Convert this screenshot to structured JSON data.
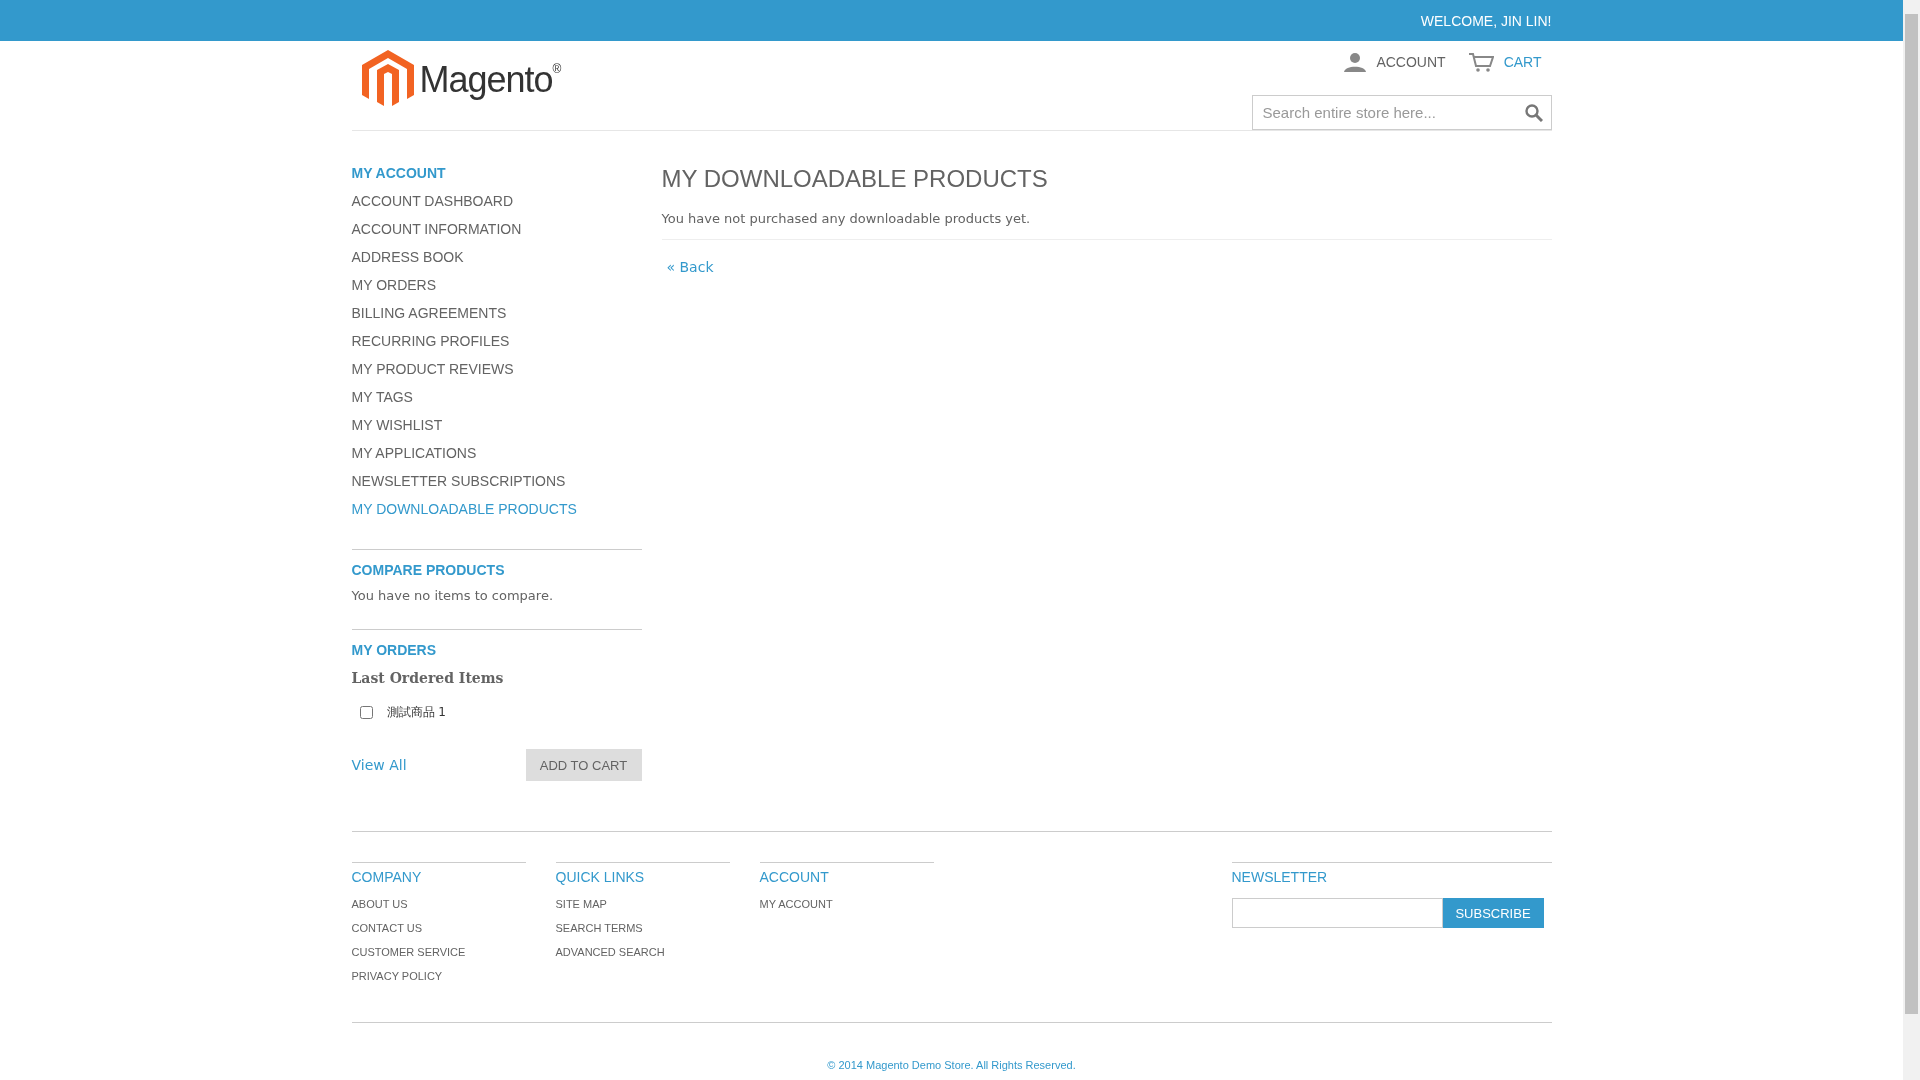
{
  "top_bar": {
    "welcome": "WELCOME, JIN LIN!"
  },
  "header": {
    "logo_text": "Magento",
    "logo_mark": "®",
    "links": [
      {
        "kind": "account",
        "label": "ACCOUNT"
      },
      {
        "kind": "cart",
        "label": "CART"
      }
    ],
    "search": {
      "placeholder": "Search entire store here..."
    }
  },
  "sidebar": {
    "title": "MY ACCOUNT",
    "items": [
      {
        "label": "ACCOUNT DASHBOARD",
        "selected": false
      },
      {
        "label": "ACCOUNT INFORMATION",
        "selected": false
      },
      {
        "label": "ADDRESS BOOK",
        "selected": false
      },
      {
        "label": "MY ORDERS",
        "selected": false
      },
      {
        "label": "BILLING AGREEMENTS",
        "selected": false
      },
      {
        "label": "RECURRING PROFILES",
        "selected": false
      },
      {
        "label": "MY PRODUCT REVIEWS",
        "selected": false
      },
      {
        "label": "MY TAGS",
        "selected": false
      },
      {
        "label": "MY WISHLIST",
        "selected": false
      },
      {
        "label": "MY APPLICATIONS",
        "selected": false
      },
      {
        "label": "NEWSLETTER SUBSCRIPTIONS",
        "selected": false
      },
      {
        "label": "MY DOWNLOADABLE PRODUCTS",
        "selected": true
      }
    ],
    "compare": {
      "title": "COMPARE PRODUCTS",
      "text": "You have no items to compare."
    },
    "orders": {
      "title": "MY ORDERS",
      "subtitle": "Last Ordered Items",
      "items": [
        {
          "name": "測試商品",
          "qty": "1",
          "checked": false
        }
      ],
      "view_all": "View All",
      "add_to_cart": "ADD TO CART"
    }
  },
  "main": {
    "title": "MY DOWNLOADABLE PRODUCTS",
    "message": "You have not purchased any downloadable products yet.",
    "back": "« Back"
  },
  "footer": {
    "columns": [
      {
        "title": "COMPANY",
        "links": [
          "ABOUT US",
          "CONTACT US",
          "CUSTOMER SERVICE",
          "PRIVACY POLICY"
        ]
      },
      {
        "title": "QUICK LINKS",
        "links": [
          "SITE MAP",
          "SEARCH TERMS",
          "ADVANCED SEARCH"
        ]
      },
      {
        "title": "ACCOUNT",
        "links": [
          "MY ACCOUNT"
        ]
      }
    ],
    "newsletter": {
      "title": "NEWSLETTER",
      "button": "SUBSCRIBE"
    },
    "copyright": "© 2014 Magento Demo Store. All Rights Reserved."
  }
}
